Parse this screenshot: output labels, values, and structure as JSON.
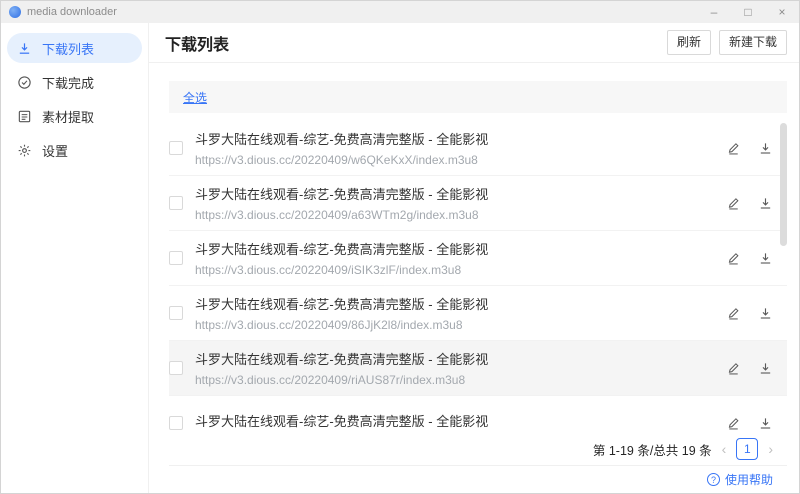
{
  "titlebar": {
    "app_title": "media downloader",
    "controls": {
      "minimize": "–",
      "maximize": "□",
      "close": "×"
    }
  },
  "sidebar": {
    "items": [
      {
        "label": "下载列表",
        "icon": "download-icon",
        "active": true
      },
      {
        "label": "下载完成",
        "icon": "check-circle-icon",
        "active": false
      },
      {
        "label": "素材提取",
        "icon": "extract-panel-icon",
        "active": false
      },
      {
        "label": "设置",
        "icon": "gear-icon",
        "active": false
      }
    ]
  },
  "header": {
    "title": "下载列表",
    "refresh_label": "刷新",
    "new_download_label": "新建下载"
  },
  "toolbar": {
    "select_all_label": "全选"
  },
  "list": {
    "items": [
      {
        "title": "斗罗大陆在线观看-综艺-免费高清完整版 - 全能影视",
        "url": "https://v3.dious.cc/20220409/w6QKeKxX/index.m3u8"
      },
      {
        "title": "斗罗大陆在线观看-综艺-免费高清完整版 - 全能影视",
        "url": "https://v3.dious.cc/20220409/a63WTm2g/index.m3u8"
      },
      {
        "title": "斗罗大陆在线观看-综艺-免费高清完整版 - 全能影视",
        "url": "https://v3.dious.cc/20220409/iSIK3zlF/index.m3u8"
      },
      {
        "title": "斗罗大陆在线观看-综艺-免费高清完整版 - 全能影视",
        "url": "https://v3.dious.cc/20220409/86JjK2l8/index.m3u8"
      },
      {
        "title": "斗罗大陆在线观看-综艺-免费高清完整版 - 全能影视",
        "url": "https://v3.dious.cc/20220409/riAUS87r/index.m3u8"
      },
      {
        "title": "斗罗大陆在线观看-综艺-免费高清完整版 - 全能影视"
      }
    ]
  },
  "pagination": {
    "summary": "第 1-19 条/总共 19 条",
    "prev_glyph": "‹",
    "page": "1",
    "next_glyph": "›"
  },
  "footer": {
    "help_label": "使用帮助",
    "help_glyph": "?"
  },
  "colors": {
    "accent": "#3875f6",
    "active_item_bg": "#e6f0fd",
    "url_text": "#a3a8ae",
    "hover_row_bg": "#f5f5f5"
  }
}
